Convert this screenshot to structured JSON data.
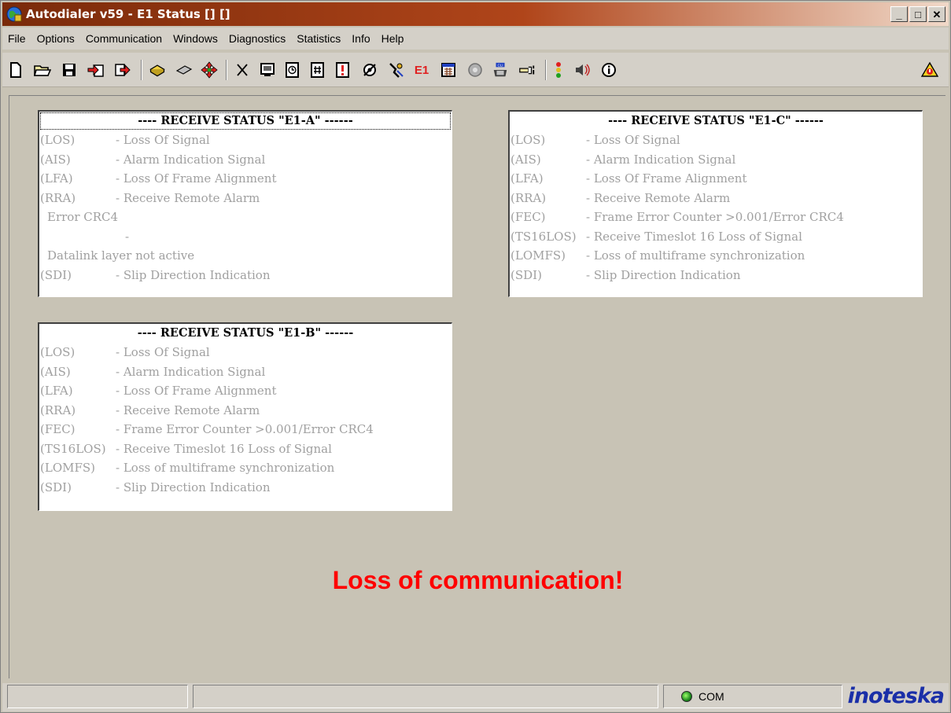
{
  "window": {
    "title": "Autodialer v59 - E1 Status [] []",
    "controls": [
      "_",
      "□",
      "✕"
    ]
  },
  "menu": [
    "File",
    "Options",
    "Communication",
    "Windows",
    "Diagnostics",
    "Statistics",
    "Info",
    "Help"
  ],
  "toolbar": {
    "e1_label": "E1",
    "cli_label": "CLI"
  },
  "panels": {
    "e1a": {
      "title": "---- RECEIVE STATUS \"E1-A\" ------",
      "rows": [
        {
          "code": "(LOS)",
          "desc": "- Loss Of Signal"
        },
        {
          "code": "(AIS)",
          "desc": "- Alarm Indication Signal"
        },
        {
          "code": "(LFA)",
          "desc": "- Loss Of Frame Alignment"
        },
        {
          "code": "(RRA)",
          "desc": "- Receive Remote Alarm"
        }
      ],
      "error_text": "Error CRC4",
      "dash_text": "-",
      "datalink_text": "Datalink layer not active",
      "last_row": {
        "code": "(SDI)",
        "desc": "- Slip Direction Indication"
      }
    },
    "e1b": {
      "title": "---- RECEIVE STATUS \"E1-B\" ------",
      "rows": [
        {
          "code": "(LOS)",
          "desc": "- Loss Of Signal"
        },
        {
          "code": "(AIS)",
          "desc": "- Alarm Indication Signal"
        },
        {
          "code": "(LFA)",
          "desc": "- Loss Of Frame Alignment"
        },
        {
          "code": "(RRA)",
          "desc": "- Receive Remote Alarm"
        },
        {
          "code": "(FEC)",
          "desc": "- Frame Error Counter >0.001/Error CRC4"
        },
        {
          "code": "(TS16LOS)",
          "desc": "- Receive Timeslot 16 Loss of Signal"
        },
        {
          "code": "(LOMFS)",
          "desc": "- Loss of multiframe synchronization"
        },
        {
          "code": "(SDI)",
          "desc": "- Slip Direction Indication"
        }
      ]
    },
    "e1c": {
      "title": "---- RECEIVE STATUS \"E1-C\" ------",
      "rows": [
        {
          "code": "(LOS)",
          "desc": "- Loss Of Signal"
        },
        {
          "code": "(AIS)",
          "desc": "- Alarm Indication Signal"
        },
        {
          "code": "(LFA)",
          "desc": "- Loss Of Frame Alignment"
        },
        {
          "code": "(RRA)",
          "desc": "- Receive Remote Alarm"
        },
        {
          "code": "(FEC)",
          "desc": "- Frame Error Counter >0.001/Error CRC4"
        },
        {
          "code": "(TS16LOS)",
          "desc": "- Receive Timeslot 16 Loss of Signal"
        },
        {
          "code": "(LOMFS)",
          "desc": "- Loss of multiframe synchronization"
        },
        {
          "code": "(SDI)",
          "desc": "- Slip Direction Indication"
        }
      ]
    }
  },
  "message": "Loss of communication!",
  "status": {
    "pane1": "",
    "pane2": "",
    "com_label": "COM",
    "logo": "inoteska"
  },
  "colors": {
    "message": "#ff0000",
    "inactive_text": "#a0a0a0",
    "logo": "#1a2fa8",
    "title_gradient_start": "#7a2a0a"
  }
}
